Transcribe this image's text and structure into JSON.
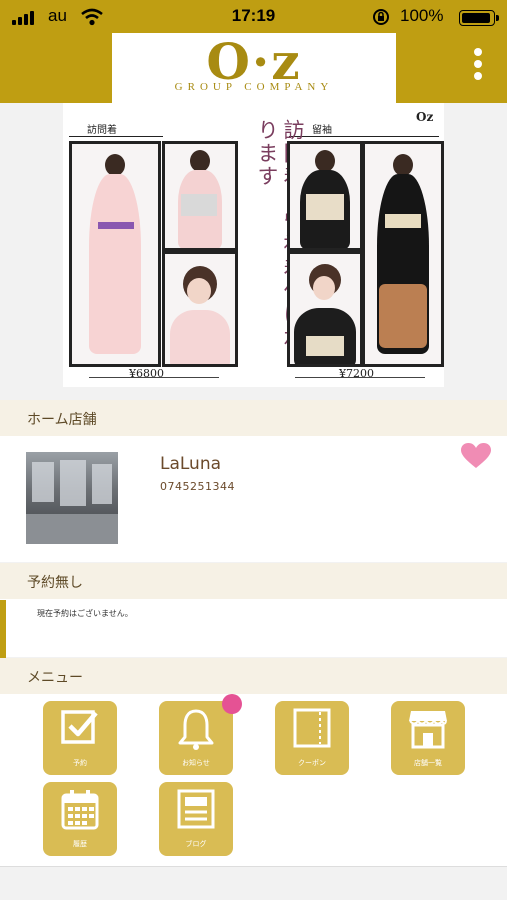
{
  "status_bar": {
    "carrier": "au",
    "time": "17:19",
    "battery": "100%"
  },
  "header": {
    "logo_main": "O·z",
    "logo_sub": "GROUP COMPANY"
  },
  "banner": {
    "left_caption": "訪問着",
    "right_caption": "留袖",
    "vertical_text": "訪問着、留袖着付け承ります",
    "mini_logo": "Oz",
    "price_left": "¥6800",
    "price_right": "¥7200"
  },
  "home_store": {
    "section_title": "ホーム店舗",
    "name": "LaLuna",
    "phone": "0745251344"
  },
  "reservation": {
    "section_title": "予約無し",
    "message": "現在予約はございません。"
  },
  "menu": {
    "section_title": "メニュー",
    "items": [
      {
        "label": "予約",
        "icon": "checkbox-icon"
      },
      {
        "label": "お知らせ",
        "icon": "bell-icon"
      },
      {
        "label": "クーポン",
        "icon": "coupon-icon"
      },
      {
        "label": "店舗一覧",
        "icon": "store-icon"
      },
      {
        "label": "履歴",
        "icon": "calendar-icon"
      },
      {
        "label": "ブログ",
        "icon": "blog-icon"
      }
    ]
  },
  "colors": {
    "brand_gold": "#bf9e12",
    "button_gold": "#d9bc54",
    "badge_pink": "#e55294",
    "heart_pink": "#f08cb4"
  }
}
